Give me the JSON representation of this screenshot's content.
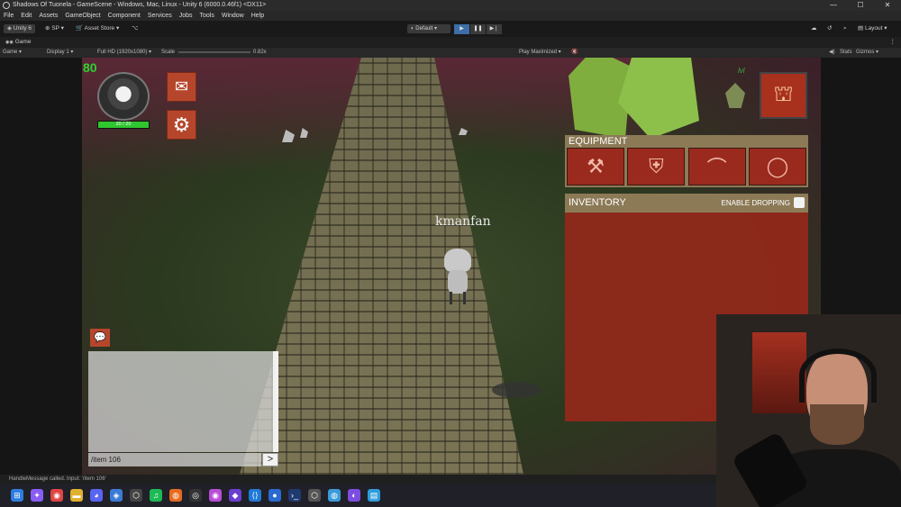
{
  "window": {
    "title": "Shadows Of Tuonela - GameScene - Windows, Mac, Linux - Unity 6 (6000.0.46f1) <DX11>",
    "controls": [
      "—",
      "☐",
      "✕"
    ]
  },
  "menu": [
    "File",
    "Edit",
    "Assets",
    "GameObject",
    "Component",
    "Services",
    "Jobs",
    "Tools",
    "Window",
    "Help"
  ],
  "toolbar": {
    "unity_label": "Unity 6",
    "account_label": "SP",
    "asset_store_label": "Asset Store",
    "layout_preset": "Default",
    "layout_label": "Layout"
  },
  "game_tab": {
    "label": "Game"
  },
  "game_bar": {
    "view_mode": "Game",
    "display": "Display 1",
    "resolution": "Full HD (1920x1080)",
    "scale_label": "Scale",
    "scale_value": "0.82x",
    "play_mode": "Play Maximized",
    "stats_label": "Stats",
    "gizmos_label": "Gizmos"
  },
  "hud": {
    "hp_value": "80",
    "hp_bar_text": "20 / 20",
    "player_name": "kmanfan",
    "pet_label": "lvl"
  },
  "equipment": {
    "header": "EQUIPMENT",
    "slots": [
      {
        "name": "axe",
        "glyph": "⚒"
      },
      {
        "name": "armor",
        "glyph": "⛨"
      },
      {
        "name": "helmet",
        "glyph": "⌒"
      },
      {
        "name": "ring",
        "glyph": "◯"
      }
    ]
  },
  "inventory": {
    "header": "INVENTORY",
    "drop_label": "ENABLE DROPPING"
  },
  "chat": {
    "input_value": "/item 106",
    "send_label": ">"
  },
  "status": {
    "message": "HandleMessage called. Input: '/item 106'"
  },
  "colors": {
    "hud_red": "#b5462c",
    "panel_tan": "#8c7a57",
    "hp_green": "#2fd12f"
  }
}
